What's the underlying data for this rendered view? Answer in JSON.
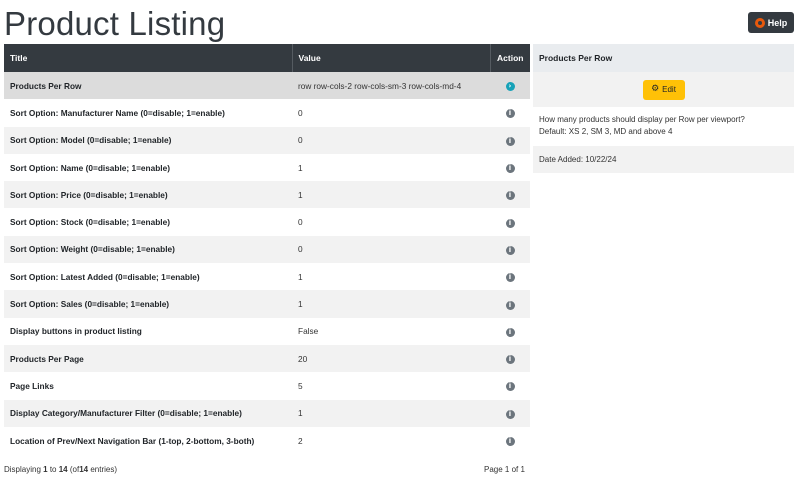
{
  "page": {
    "title": "Product Listing"
  },
  "help": {
    "label": "Help",
    "icon": "lifebuoy-icon"
  },
  "table": {
    "headers": {
      "title": "Title",
      "value": "Value",
      "action": "Action"
    },
    "rows": [
      {
        "title": "Products Per Row",
        "value": "row row-cols-2 row-cols-sm-3 row-cols-md-4",
        "selected": true
      },
      {
        "title": "Sort Option: Manufacturer Name (0=disable; 1=enable)",
        "value": "0"
      },
      {
        "title": "Sort Option: Model (0=disable; 1=enable)",
        "value": "0"
      },
      {
        "title": "Sort Option: Name (0=disable; 1=enable)",
        "value": "1"
      },
      {
        "title": "Sort Option: Price (0=disable; 1=enable)",
        "value": "1"
      },
      {
        "title": "Sort Option: Stock (0=disable; 1=enable)",
        "value": "0"
      },
      {
        "title": "Sort Option: Weight (0=disable; 1=enable)",
        "value": "0"
      },
      {
        "title": "Sort Option: Latest Added (0=disable; 1=enable)",
        "value": "1"
      },
      {
        "title": "Sort Option: Sales (0=disable; 1=enable)",
        "value": "1"
      },
      {
        "title": "Display buttons in product listing",
        "value": "False"
      },
      {
        "title": "Products Per Page",
        "value": "20"
      },
      {
        "title": "Page Links",
        "value": "5"
      },
      {
        "title": "Display Category/Manufacturer Filter (0=disable; 1=enable)",
        "value": "1"
      },
      {
        "title": "Location of Prev/Next Navigation Bar (1-top, 2-bottom, 3-both)",
        "value": "2"
      }
    ]
  },
  "footer": {
    "prefix": "Displaying",
    "from": "1",
    "to_word": "to",
    "to": "14",
    "of_prefix": "(of",
    "total": "14",
    "suffix": "entries)",
    "page_info": "Page 1 of 1"
  },
  "side": {
    "heading": "Products Per Row",
    "edit_label": "Edit",
    "edit_icon": "gears-icon",
    "description_line1": "How many products should display per Row per viewport?",
    "description_line2": "Default: XS 2, SM 3, MD and above 4",
    "date_added": "Date Added: 10/22/24"
  },
  "colors": {
    "header_bg": "#343a40",
    "edit_button": "#ffc107",
    "active_icon": "#17a2b8",
    "info_icon": "#6c757d"
  }
}
